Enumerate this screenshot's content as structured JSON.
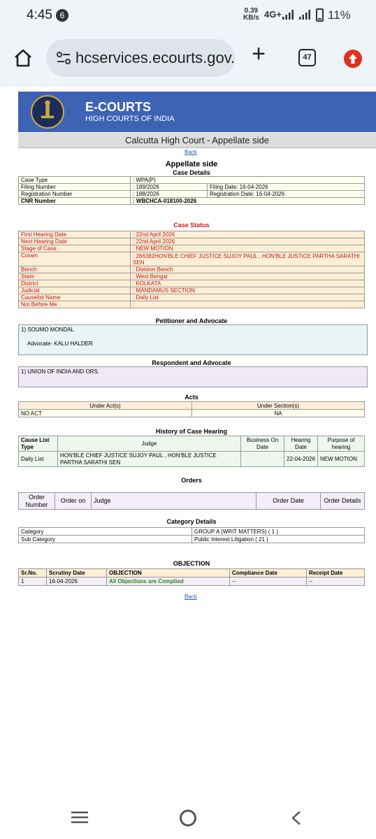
{
  "status_bar": {
    "time": "4:45",
    "notification_count": "6",
    "speed_value": "0.39",
    "speed_unit": "KB/s",
    "network": "4G+",
    "battery": "11%"
  },
  "browser": {
    "url": "hcservices.ecourts.gov.in",
    "tab_count": "47"
  },
  "site": {
    "title": "E-COURTS",
    "subtitle": "HIGH COURTS OF INDIA",
    "court": "Calcutta High Court - Appellate side",
    "back_label": "Back"
  },
  "case_details": {
    "section": "Appellate side",
    "heading": "Case Details",
    "case_type_label": "Case Type",
    "case_type": ": WPA(P)",
    "filing_number_label": "Filing Number",
    "filing_number": ": 189/2026",
    "filing_date": "Filing Date: 16-04-2026",
    "registration_number_label": "Registration Number",
    "registration_number": ": 188/2026",
    "registration_date": "Registration Date: 16-04-2026",
    "cnr_label": "CNR Number",
    "cnr": ": WBCHCA-018100-2026"
  },
  "case_status": {
    "heading": "Case Status",
    "rows": [
      {
        "label": "First Hearing Date",
        "value": ": 22nd April 2026"
      },
      {
        "label": "Next Hearing Date",
        "value": ": 22nd April 2026"
      },
      {
        "label": "Stage of Case",
        "value": ": NEW MOTION"
      },
      {
        "label": "Coram",
        "value": ": 266382HON'BLE CHIEF JUSTICE SUJOY PAUL , HON'BLE JUSTICE PARTHA SARATHI SEN"
      },
      {
        "label": "Bench",
        "value": ": Division Bench"
      },
      {
        "label": "State",
        "value": ": West Bengal"
      },
      {
        "label": "District",
        "value": ": KOLKATA"
      },
      {
        "label": "Judicial",
        "value": ": MANDAMUS SECTION"
      },
      {
        "label": "Causelist Name",
        "value": ": Daily List"
      },
      {
        "label": "Not Before Me",
        "value": ":"
      }
    ]
  },
  "petitioner": {
    "heading": "Petitioner and Advocate",
    "name": "1) SOUMO MONDAL",
    "advocate": "Advocate- KALU HALDER"
  },
  "respondent": {
    "heading": "Respondent and Advocate",
    "name": "1) UNION OF INDIA AND ORS."
  },
  "acts": {
    "heading": "Acts",
    "col_act": "Under Act(s)",
    "col_section": "Under Section(s)",
    "act": "NO ACT",
    "section": "NA"
  },
  "history": {
    "heading": "History of Case Hearing",
    "col_causelist": "Cause List Type",
    "col_judge": "Judge",
    "col_business": "Business On Date",
    "col_hearing": "Hearing Date",
    "col_purpose": "Purpose of hearing",
    "row_causelist": "Daily List",
    "row_judge": "HON'BLE CHIEF JUSTICE SUJOY PAUL , HON'BLE JUSTICE PARTHA SARATHI SEN",
    "row_business": "",
    "row_hearing": "22-04-2026",
    "row_purpose": "NEW MOTION"
  },
  "orders": {
    "heading": "Orders",
    "col_number": "Order Number",
    "col_on": "Order on",
    "col_judge": "Judge",
    "col_date": "Order Date",
    "col_details": "Order Details"
  },
  "category": {
    "heading": "Category Details",
    "category_label": "Category",
    "category_value": "GROUP A (WRIT MATTERS) ( 1 )",
    "sub_label": "Sub Category",
    "sub_value": "Public Interest Litigation ( 21 )"
  },
  "objection": {
    "heading": "OBJECTION",
    "col_sr": "Sr.No.",
    "col_scrutiny": "Scrutiny Date",
    "col_objection": "OBJECTION",
    "col_compliance": "Compliance Date",
    "col_receipt": "Receipt Date",
    "sr": "1",
    "scrutiny": "16-04-2026",
    "text": "All Objections are Complied",
    "compliance": "--",
    "receipt": "--"
  }
}
